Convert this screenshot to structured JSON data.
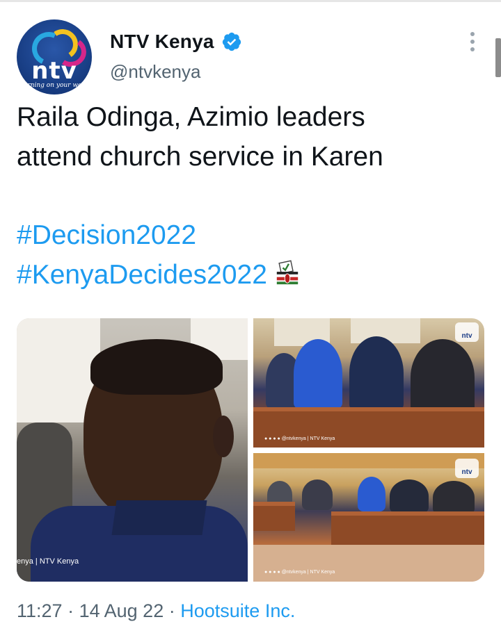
{
  "author": {
    "display_name": "NTV Kenya",
    "handle": "@ntvkenya",
    "verified": true,
    "avatar": {
      "wordmark": "ntv",
      "tagline": "turning on your world"
    }
  },
  "tweet": {
    "text_lines": [
      "Raila Odinga, Azimio leaders",
      "attend church service in Karen"
    ],
    "hashtags": [
      "#Decision2022",
      "#KenyaDecides2022"
    ],
    "emoji": "ballot-box-with-kenya-flag"
  },
  "media": {
    "photo_main_caption": "enya | NTV Kenya",
    "photo_watermark": "ntv"
  },
  "meta": {
    "time": "11:27",
    "separator": "·",
    "date": "14 Aug 22",
    "source": "Hootsuite Inc."
  },
  "colors": {
    "link": "#1d9bf0",
    "text": "#0f1419",
    "secondary": "#536471",
    "verified": "#1d9bf0",
    "brand_blue": "#193f86"
  },
  "icons": {
    "verified": "verified-badge-icon",
    "more": "more-options-icon"
  }
}
